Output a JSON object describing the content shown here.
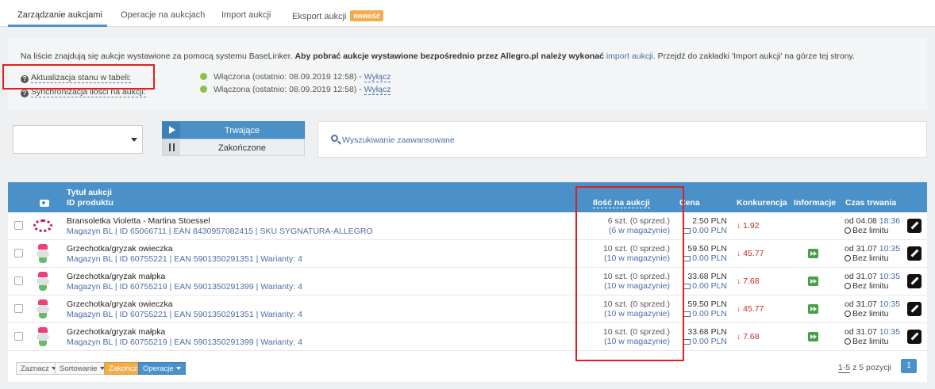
{
  "tabs": [
    {
      "label": "Zarządzanie aukcjami",
      "active": true
    },
    {
      "label": "Operacje na aukcjach",
      "active": false
    },
    {
      "label": "Import aukcji",
      "active": false
    },
    {
      "label": "Eksport aukcji",
      "active": false,
      "badge": "nowość"
    }
  ],
  "info": {
    "text_a": "Na liście znajdują się aukcje wystawione za pomocą systemu BaseLinker.",
    "text_b": "Aby pobrać aukcje wystawione bezpośrednio przez Allegro.pl należy wykonać",
    "link": "import aukcji",
    "text_c": ". Przejdź do zakładki 'Import aukcji' na górze tej strony."
  },
  "status": [
    {
      "label": "Aktualizacja stanu w tabeli:",
      "value": "Włączona (ostatnio: 08.09.2019 12:58) -",
      "action": "Wyłącz",
      "dot_color": "#8bc34a"
    },
    {
      "label": "Synchronizacja ilości na aukcji:",
      "value": "Włączona (ostatnio: 08.09.2019 12:58) -",
      "action": "Wyłącz",
      "dot_color": "#8bc34a"
    }
  ],
  "filters": {
    "select_value": "",
    "active_btn": "Trwające",
    "ended_btn": "Zakończone",
    "advanced_search": "Wyszukiwanie zaawansowane"
  },
  "table": {
    "headers": {
      "title": "Tytuł aukcji",
      "product_id": "ID produktu",
      "quantity": "Ilość na aukcji",
      "price": "Cena",
      "competition": "Konkurencja",
      "information": "Informacje",
      "duration": "Czas trwania"
    },
    "rows": [
      {
        "thumb": "bracelet",
        "title": "Bransoletka Violetta - Martina Stoessel",
        "meta": "Magazyn BL | ID 65066711 | EAN 8430957082415 | SKU SYGNATURA-ALLEGRO",
        "qty": "6 szt. (0 sprzed.)",
        "stock": "(6 w magazynie)",
        "price": "2.50 PLN",
        "price2": "0.00 PLN",
        "competition": "1.92",
        "has_info": false,
        "date": "od 04.08",
        "time": "18:36",
        "limit": "Bez limitu"
      },
      {
        "thumb": "toy",
        "title": "Grzechotka/gryzak owieczka",
        "meta": "Magazyn BL | ID 60755221 | EAN 5901350291351 | Warianty: 4",
        "qty": "10 szt. (0 sprzed.)",
        "stock": "(10 w magazynie)",
        "price": "59.50 PLN",
        "price2": "0.00 PLN",
        "competition": "45.77",
        "has_info": true,
        "date": "od 31.07",
        "time": "10:35",
        "limit": "Bez limitu"
      },
      {
        "thumb": "toy",
        "title": "Grzechotka/gryzak małpka",
        "meta": "Magazyn BL | ID 60755219 | EAN 5901350291399 | Warianty: 4",
        "qty": "10 szt. (0 sprzed.)",
        "stock": "(10 w magazynie)",
        "price": "33.68 PLN",
        "price2": "0.00 PLN",
        "competition": "7.68",
        "has_info": true,
        "date": "od 31.07",
        "time": "10:35",
        "limit": "Bez limitu"
      },
      {
        "thumb": "toy",
        "title": "Grzechotka/gryzak owieczka",
        "meta": "Magazyn BL | ID 60755221 | EAN 5901350291351 | Warianty: 4",
        "qty": "10 szt. (0 sprzed.)",
        "stock": "(10 w magazynie)",
        "price": "59.50 PLN",
        "price2": "0.00 PLN",
        "competition": "45.77",
        "has_info": true,
        "date": "od 31.07",
        "time": "10:35",
        "limit": "Bez limitu"
      },
      {
        "thumb": "toy",
        "title": "Grzechotka/gryzak małpka",
        "meta": "Magazyn BL | ID 60755219 | EAN 5901350291399 | Warianty: 4",
        "qty": "10 szt. (0 sprzed.)",
        "stock": "(10 w magazynie)",
        "price": "33.68 PLN",
        "price2": "0.00 PLN",
        "competition": "7.68",
        "has_info": true,
        "date": "od 31.07",
        "time": "10:35",
        "limit": "Bez limitu"
      }
    ]
  },
  "footer": {
    "select_btn": "Zaznacz",
    "sort_btn": "Sortowanie",
    "end_btn": "Zakończ",
    "ops_btn": "Operacje",
    "range": "1-5",
    "range_rest": "z 5 pozycji",
    "page": "1"
  },
  "colors": {
    "accent": "#4a90c9",
    "link": "#4a6fa5",
    "status_on": "#8bc34a",
    "price_drop": "#e53935",
    "highlight": "#e02020"
  }
}
